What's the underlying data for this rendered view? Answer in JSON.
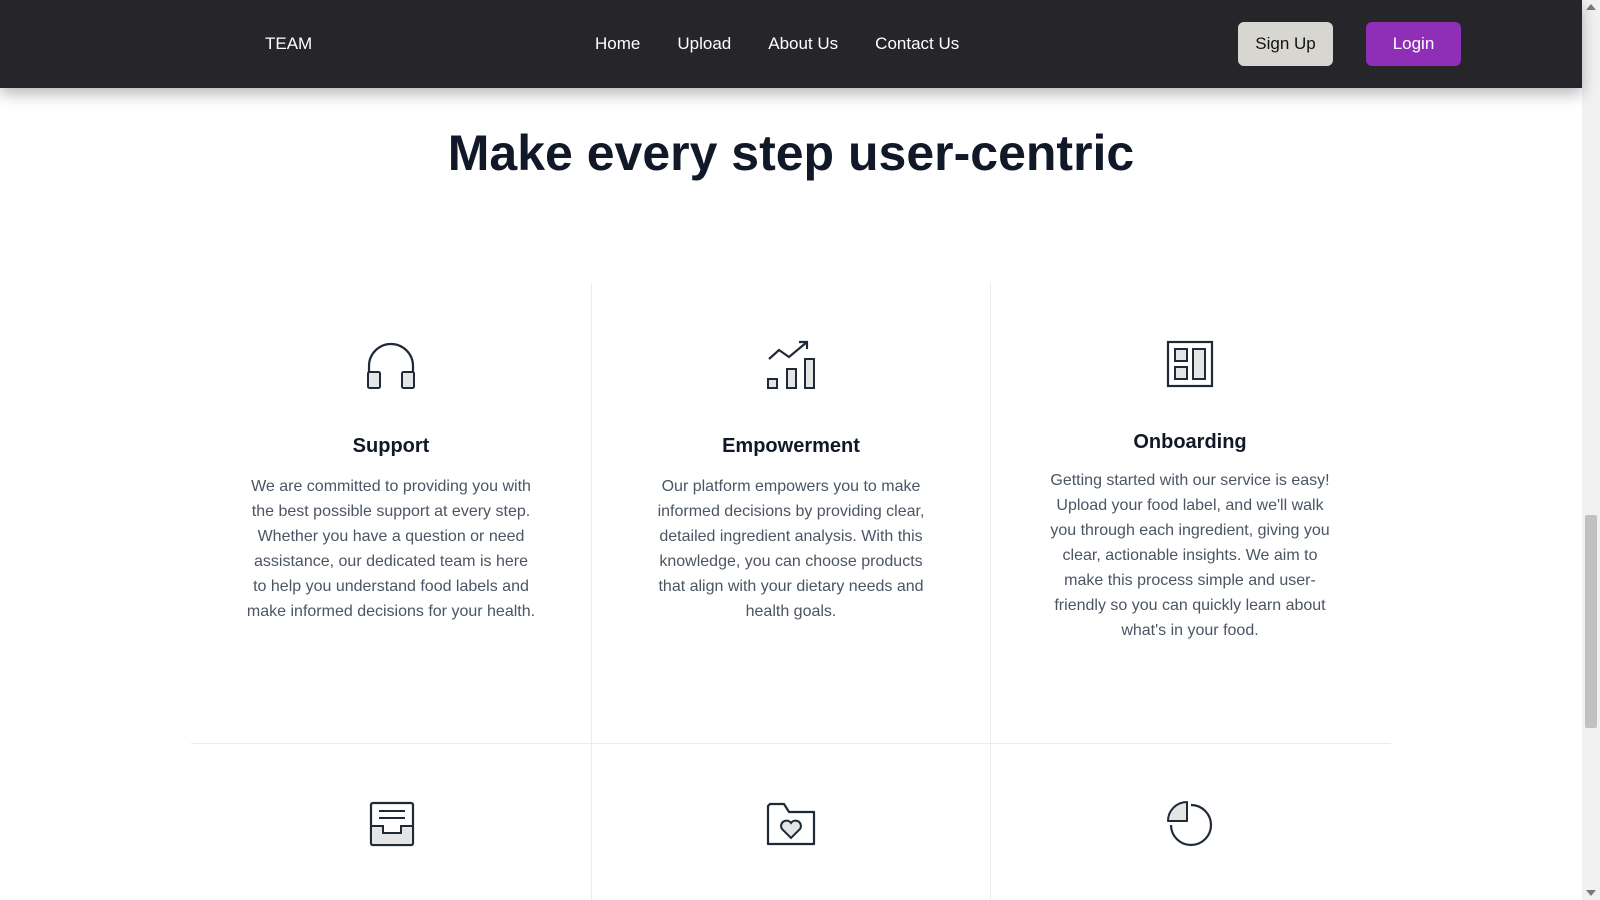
{
  "nav": {
    "brand": "TEAM",
    "links": [
      "Home",
      "Upload",
      "About Us",
      "Contact Us"
    ],
    "signup_label": "Sign Up",
    "login_label": "Login"
  },
  "main": {
    "headline": "Make every step user-centric",
    "features": [
      {
        "icon": "headphones-icon",
        "title": "Support",
        "text": "We are committed to providing you with the best possible support at every step. Whether you have a question or need assistance, our dedicated team is here to help you understand food labels and make informed decisions for your health."
      },
      {
        "icon": "chart-growth-icon",
        "title": "Empowerment",
        "text": "Our platform empowers you to make informed decisions by providing clear, detailed ingredient analysis. With this knowledge, you can choose products that align with your dietary needs and health goals."
      },
      {
        "icon": "layout-panels-icon",
        "title": "Onboarding",
        "text": "Getting started with our service is easy! Upload your food label, and we'll walk you through each ingredient, giving you clear, actionable insights. We aim to make this process simple and user-friendly so you can quickly learn about what's in your food."
      }
    ],
    "second_row_icons": [
      "inbox-tray-icon",
      "folder-heart-icon",
      "pie-chart-icon"
    ]
  },
  "colors": {
    "nav_bg": "#25252a",
    "signup_bg": "#d7d6d1",
    "login_bg": "#8f2fb8",
    "heading": "#111827",
    "body_text": "#4b5563"
  }
}
